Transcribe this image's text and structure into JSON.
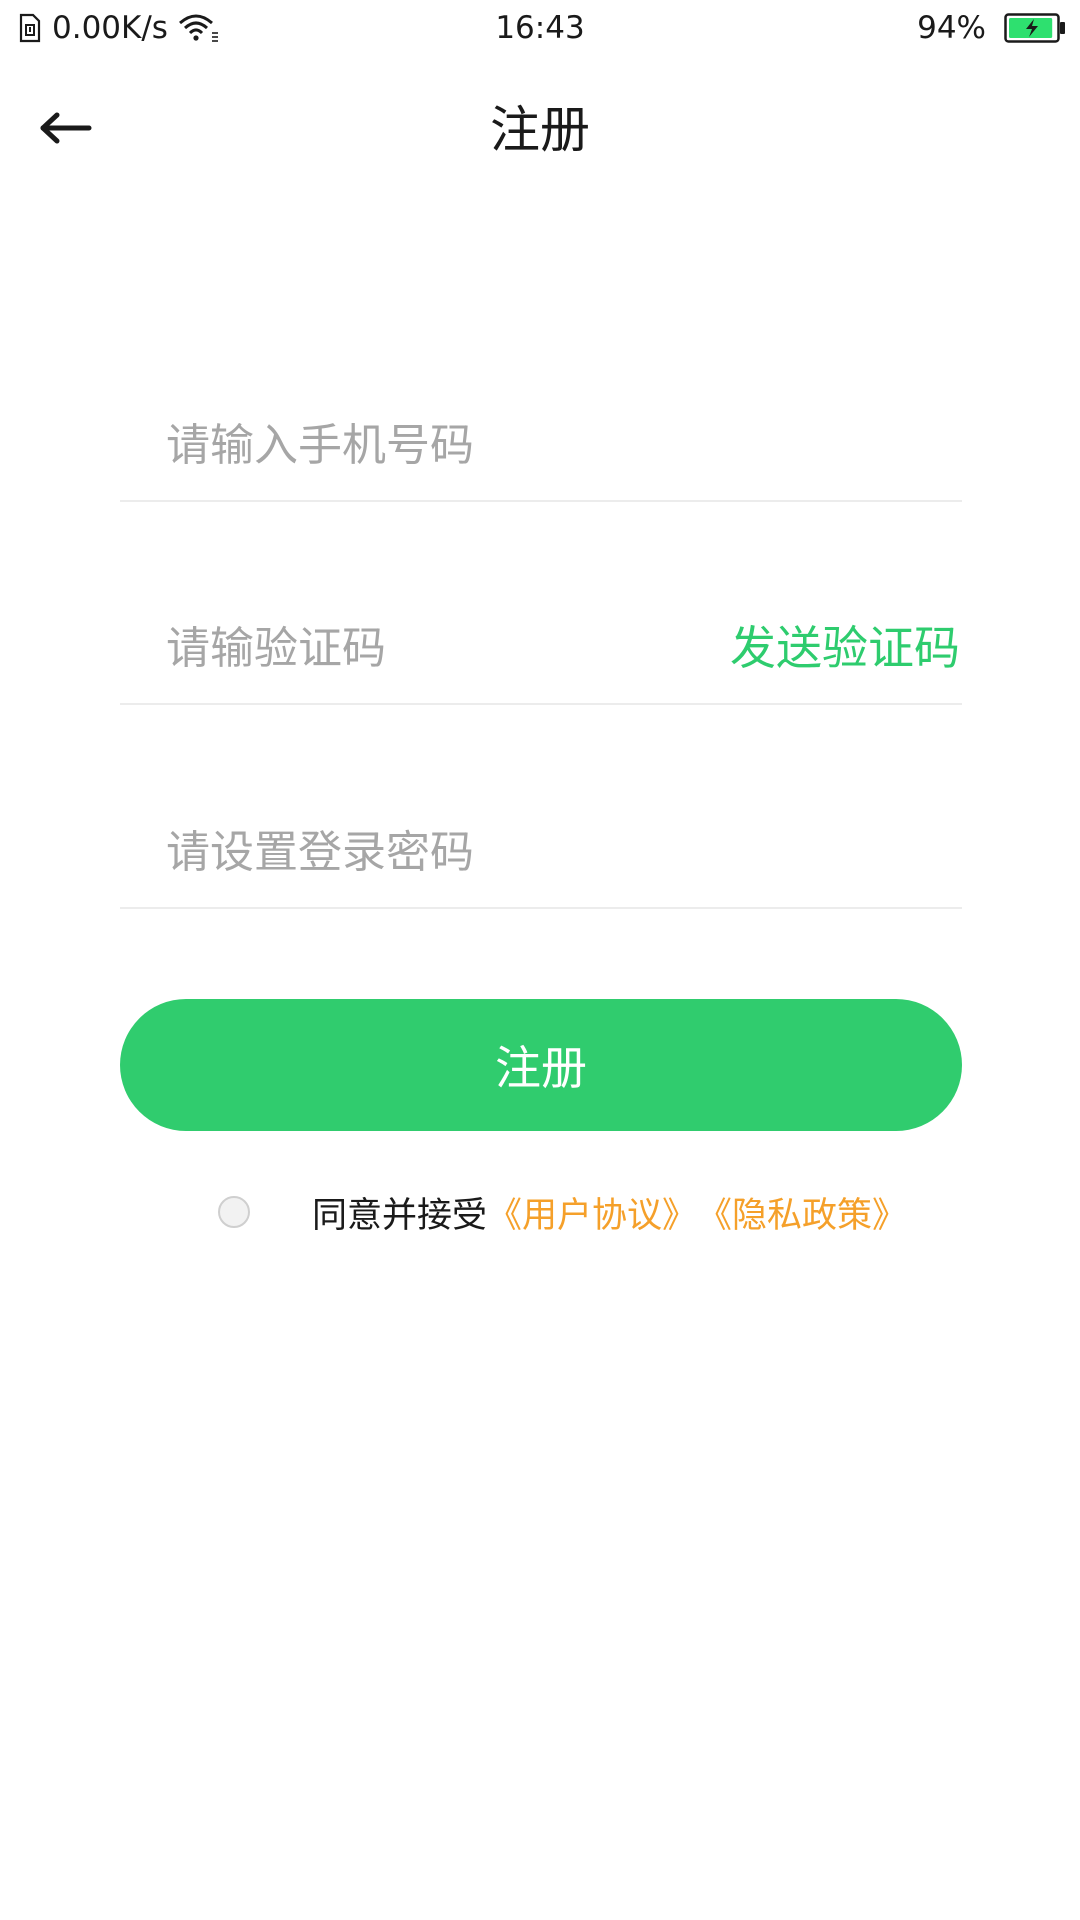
{
  "status_bar": {
    "network_speed": "0.00K/s",
    "time": "16:43",
    "battery_percent": "94%",
    "battery_level": 0.94,
    "battery_color": "#2ee06f",
    "icons": [
      "sim-icon",
      "wifi-icon",
      "battery-charging-icon"
    ]
  },
  "header": {
    "back_icon": "arrow-left-icon",
    "title": "注册"
  },
  "form": {
    "phone_placeholder": "请输入手机号码",
    "code_placeholder": "请输验证码",
    "send_code_label": "发送验证码",
    "password_placeholder": "请设置登录密码",
    "submit_label": "注册"
  },
  "agreement": {
    "checked": false,
    "prefix": "同意并接受",
    "user_agreement": "《用户协议》",
    "privacy_policy": "《隐私政策》"
  },
  "colors": {
    "accent_green": "#30cc6e",
    "link_orange": "#f5a02a",
    "placeholder_gray": "#a6a6a6",
    "divider": "#ececec"
  }
}
